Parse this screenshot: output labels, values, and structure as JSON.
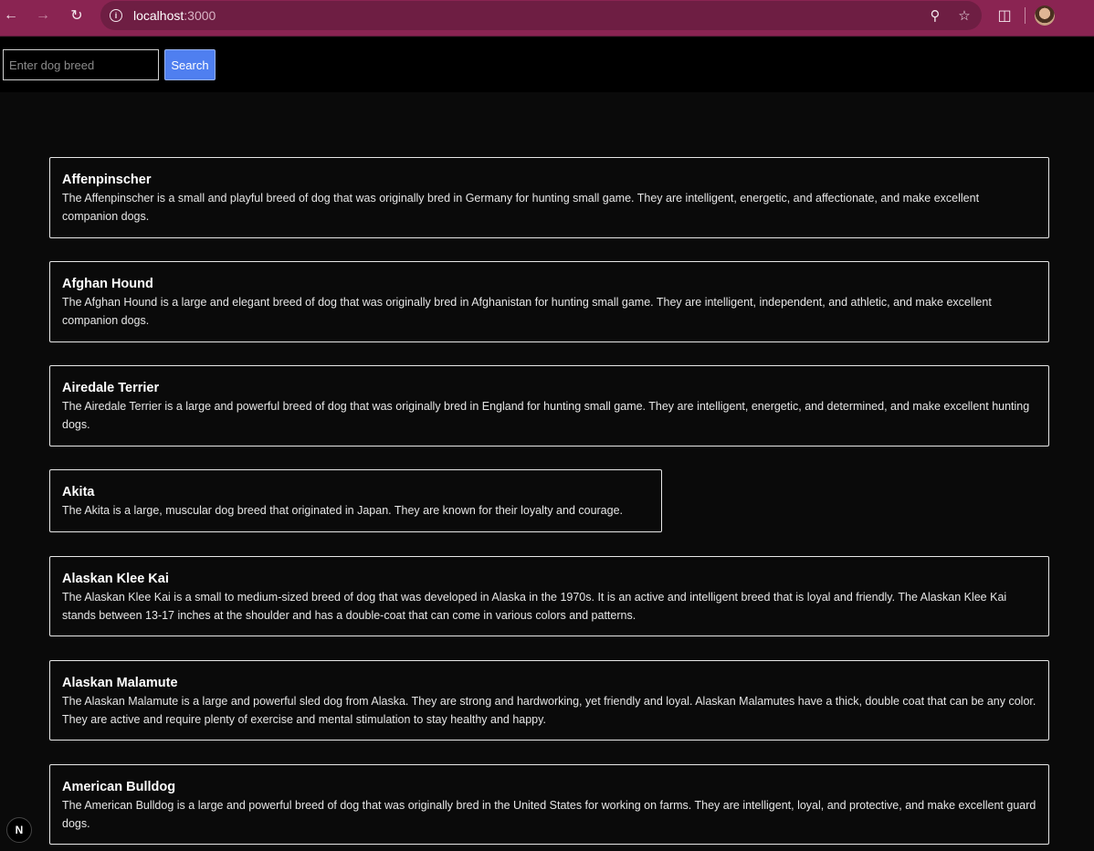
{
  "browser": {
    "url_host": "localhost",
    "url_port": ":3000",
    "icons": {
      "back": "back-arrow-icon",
      "forward": "forward-arrow-icon",
      "reload": "reload-icon",
      "site_info": "site-info-icon",
      "zoom": "zoom-icon",
      "bookmark": "star-icon",
      "extensions": "puzzle-icon",
      "profile": "avatar"
    }
  },
  "search": {
    "placeholder": "Enter dog breed",
    "value": "",
    "button_label": "Search"
  },
  "breeds": [
    {
      "name": "Affenpinscher",
      "description": "The Affenpinscher is a small and playful breed of dog that was originally bred in Germany for hunting small game. They are intelligent, energetic, and affectionate, and make excellent companion dogs."
    },
    {
      "name": "Afghan Hound",
      "description": "The Afghan Hound is a large and elegant breed of dog that was originally bred in Afghanistan for hunting small game. They are intelligent, independent, and athletic, and make excellent companion dogs."
    },
    {
      "name": "Airedale Terrier",
      "description": "The Airedale Terrier is a large and powerful breed of dog that was originally bred in England for hunting small game. They are intelligent, energetic, and determined, and make excellent hunting dogs."
    },
    {
      "name": "Akita",
      "description": "The Akita is a large, muscular dog breed that originated in Japan. They are known for their loyalty and courage."
    },
    {
      "name": "Alaskan Klee Kai",
      "description": "The Alaskan Klee Kai is a small to medium-sized breed of dog that was developed in Alaska in the 1970s. It is an active and intelligent breed that is loyal and friendly. The Alaskan Klee Kai stands between 13-17 inches at the shoulder and has a double-coat that can come in various colors and patterns."
    },
    {
      "name": "Alaskan Malamute",
      "description": "The Alaskan Malamute is a large and powerful sled dog from Alaska. They are strong and hardworking, yet friendly and loyal. Alaskan Malamutes have a thick, double coat that can be any color. They are active and require plenty of exercise and mental stimulation to stay healthy and happy."
    },
    {
      "name": "American Bulldog",
      "description": "The American Bulldog is a large and powerful breed of dog that was originally bred in the United States for working on farms. They are intelligent, loyal, and protective, and make excellent guard dogs."
    }
  ],
  "dev_badge": {
    "label": "N"
  },
  "colors": {
    "browser_frame": "#8a2452",
    "page_background": "#0a0a0a",
    "header_background": "#000000",
    "search_button": "#4f7ff0",
    "card_border": "#e8e8e8"
  }
}
